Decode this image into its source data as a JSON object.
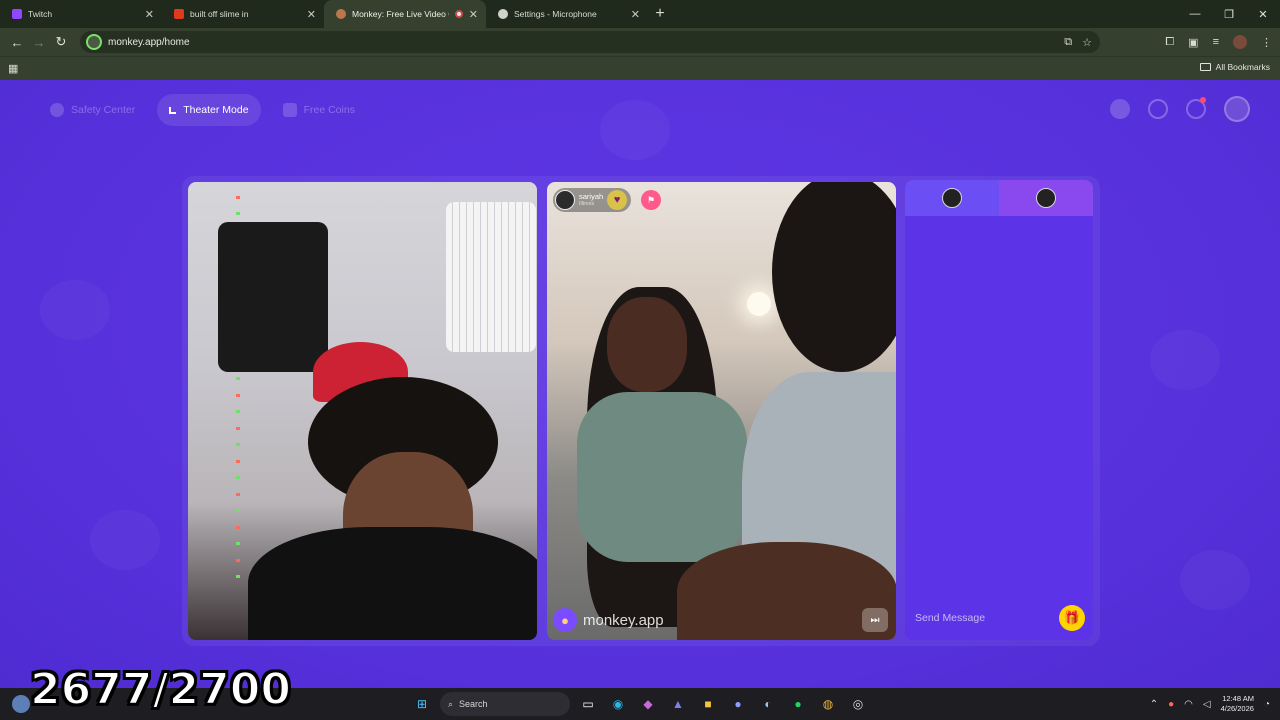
{
  "browser": {
    "tabs": [
      {
        "label": "Twitch",
        "favicon_color": "#9146ff"
      },
      {
        "label": "built off slime in",
        "favicon_color": "#e03a1e"
      },
      {
        "label": "Monkey: Free Live Video Ch",
        "favicon_color": "#b9774a"
      },
      {
        "label": "Settings - Microphone",
        "favicon_color": "#cfd3ca"
      }
    ],
    "active_tab": 2,
    "url": "monkey.app/home",
    "bookmarks_label": "All Bookmarks"
  },
  "page": {
    "nav": {
      "safety": "Safety Center",
      "theater": "Theater Mode",
      "coins": "Free Coins"
    },
    "match": {
      "username": "sariyah",
      "location": "Illinois"
    },
    "watermark": "monkey.app",
    "chat_placeholder": "Send Message"
  },
  "overlay": {
    "counter": "2677/2700"
  },
  "taskbar": {
    "search_label": "Search",
    "time": "12:48 AM",
    "date": "4/26/2026"
  },
  "colors": {
    "page_bg": "#5b34e0",
    "chat_tab_a": "#6c4ef5",
    "chat_tab_b": "#8a48ef",
    "gift": "#ffd400"
  }
}
